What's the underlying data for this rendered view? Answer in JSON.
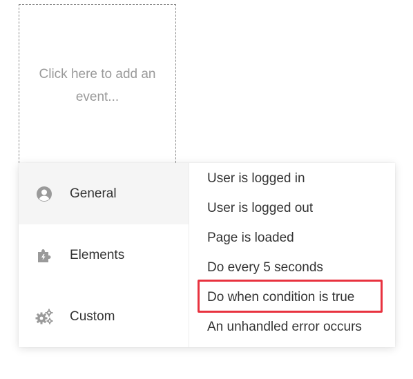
{
  "placeholder": {
    "text": "Click here to add an event..."
  },
  "categories": [
    {
      "label": "General",
      "icon": "user-circle-icon",
      "selected": true
    },
    {
      "label": "Elements",
      "icon": "puzzle-piece-icon",
      "selected": false
    },
    {
      "label": "Custom",
      "icon": "gears-icon",
      "selected": false
    }
  ],
  "options": [
    {
      "label": "User is logged in"
    },
    {
      "label": "User is logged out"
    },
    {
      "label": "Page is loaded"
    },
    {
      "label": "Do every 5 seconds"
    },
    {
      "label": "Do when condition is true",
      "highlighted": true
    },
    {
      "label": "An unhandled error occurs"
    }
  ],
  "colors": {
    "highlight": "#e8323f",
    "icon": "#9a9a9a",
    "text": "#333333"
  }
}
